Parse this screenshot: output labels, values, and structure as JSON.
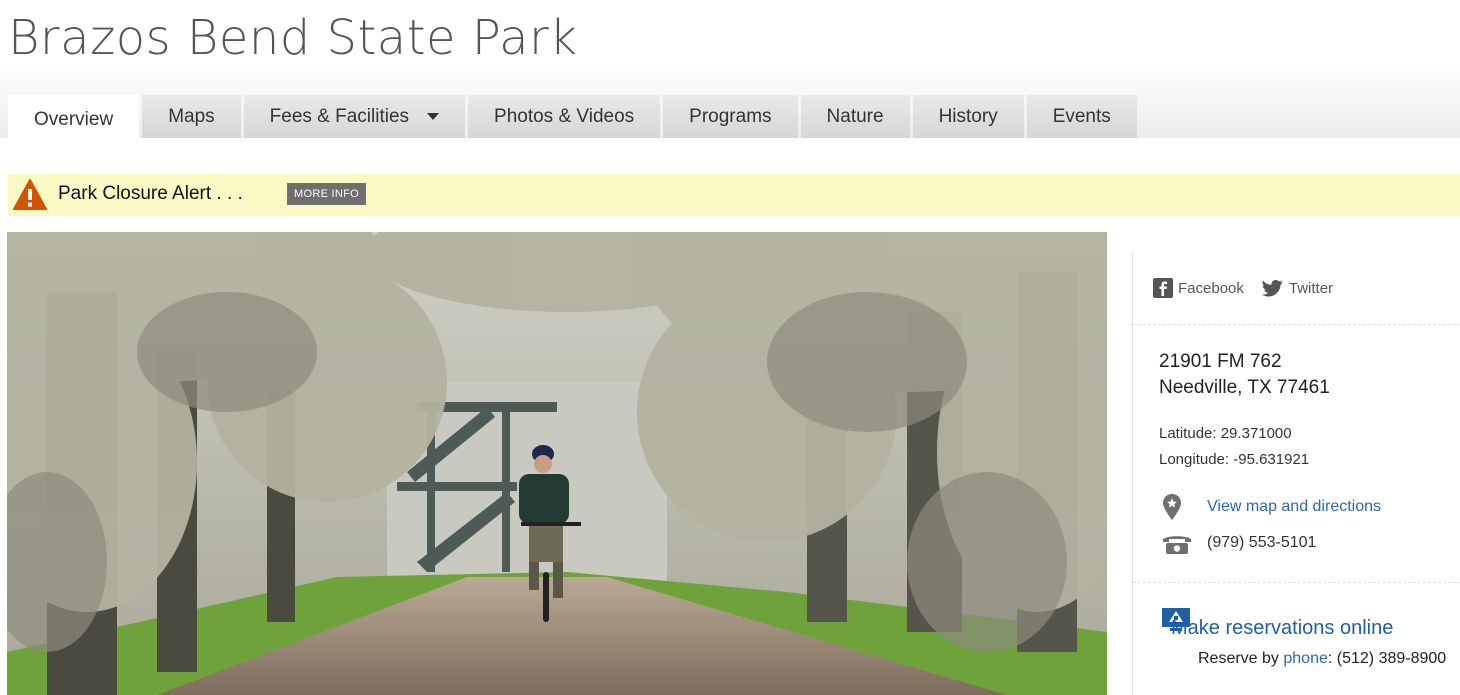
{
  "header": {
    "title": "Brazos Bend State Park"
  },
  "tabs": [
    {
      "label": "Overview"
    },
    {
      "label": "Maps"
    },
    {
      "label": "Fees & Facilities"
    },
    {
      "label": "Photos & Videos"
    },
    {
      "label": "Programs"
    },
    {
      "label": "Nature"
    },
    {
      "label": "History"
    },
    {
      "label": "Events"
    }
  ],
  "alert": {
    "text": "Park Closure Alert . . .",
    "button": "MORE INFO"
  },
  "sidebar": {
    "facebook": "Facebook",
    "twitter": "Twitter",
    "address_line1": "21901 FM 762",
    "address_line2": "Needville, TX 77461",
    "latitude": "Latitude: 29.371000",
    "longitude": "Longitude: -95.631921",
    "map_link": "View map and directions",
    "phone": "(979) 553-5101",
    "reservations_link": "Make reservations online",
    "reserve_prefix": "Reserve by ",
    "reserve_phone_link": "phone",
    "reserve_phone": ": (512) 389-8900"
  },
  "colors": {
    "alert_bg": "#fdf9c4",
    "alert_icon": "#d35400",
    "link": "#2a6ab0",
    "tab_bg": "#dedede"
  },
  "icons": [
    "warning-icon",
    "facebook-icon",
    "twitter-icon",
    "map-pin-icon",
    "phone-icon",
    "reservation-icon"
  ]
}
